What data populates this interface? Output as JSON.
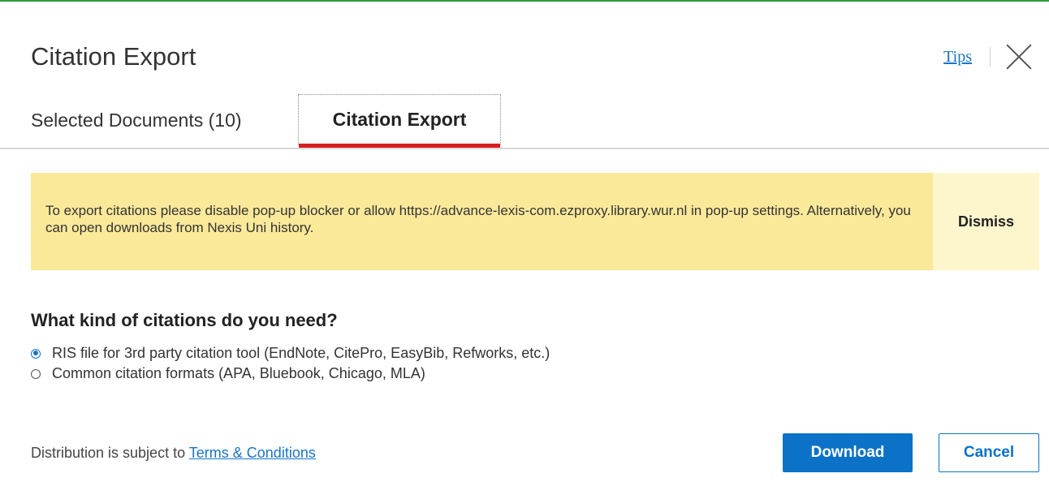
{
  "dialog": {
    "title": "Citation Export",
    "tips_label": "Tips"
  },
  "tabs": [
    {
      "label": "Selected Documents (10)",
      "active": false
    },
    {
      "label": "Citation Export",
      "active": true
    }
  ],
  "banner": {
    "message": "To export citations please disable pop-up blocker or allow https://advance-lexis-com.ezproxy.library.wur.nl in pop-up settings. Alternatively, you can open downloads from Nexis Uni history.",
    "dismiss_label": "Dismiss"
  },
  "citations": {
    "question": "What kind of citations do you need?",
    "options": [
      {
        "label": "RIS file for 3rd party citation tool (EndNote, CitePro, EasyBib, Refworks, etc.)",
        "selected": true
      },
      {
        "label": "Common citation formats (APA, Bluebook, Chicago, MLA)",
        "selected": false
      }
    ]
  },
  "footer": {
    "note_prefix": "Distribution is subject to",
    "terms_link": "Terms & Conditions",
    "download_label": "Download",
    "cancel_label": "Cancel"
  },
  "colors": {
    "accent": "#0b72c7",
    "tab_underline": "#d81e1e",
    "banner_bg": "#fbe99a",
    "top_border": "#2e9a3a"
  }
}
